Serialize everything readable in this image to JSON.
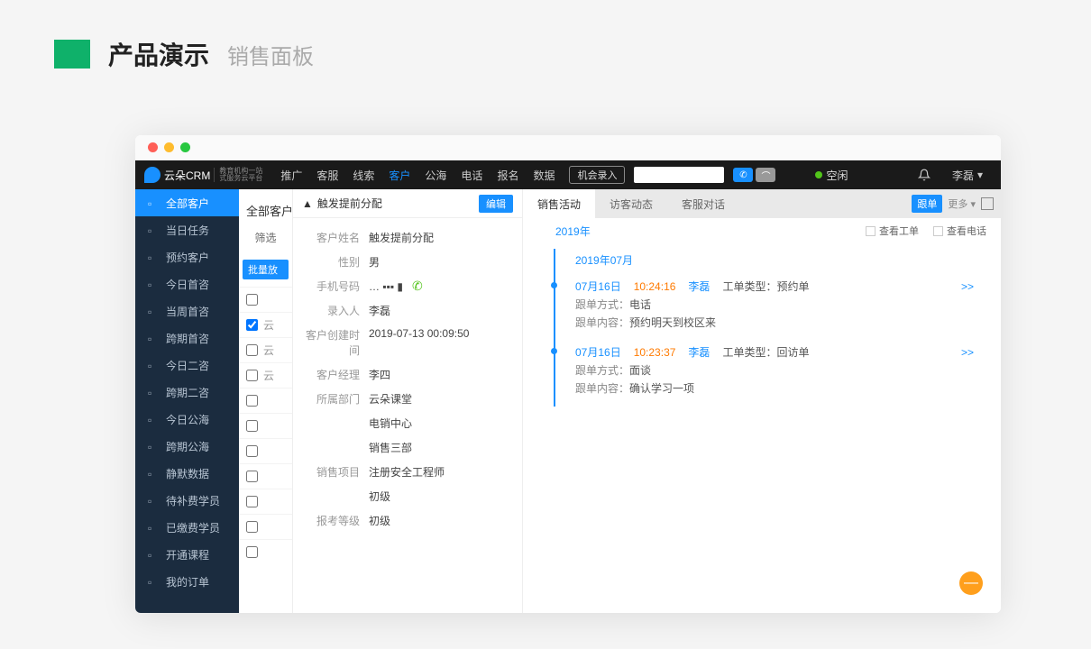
{
  "outer": {
    "title_main": "产品演示",
    "title_sub": "销售面板"
  },
  "topnav": {
    "logo": {
      "name": "云朵CRM",
      "tagline1": "教育机构一站",
      "tagline2": "式服务云平台"
    },
    "items": [
      "推广",
      "客服",
      "线索",
      "客户",
      "公海",
      "电话",
      "报名",
      "数据"
    ],
    "active_index": 3,
    "entry_btn": "机会录入",
    "status": "空闲",
    "user": "李磊"
  },
  "sidebar": {
    "items": [
      "全部客户",
      "当日任务",
      "预约客户",
      "今日首咨",
      "当周首咨",
      "跨期首咨",
      "今日二咨",
      "跨期二咨",
      "今日公海",
      "跨期公海",
      "静默数据",
      "待补费学员",
      "已缴费学员",
      "开通课程",
      "我的订单"
    ],
    "active_index": 0
  },
  "list": {
    "title": "全部客户",
    "filter_prefix": "筛选",
    "batch_btn": "批量放",
    "rows": [
      "",
      "云",
      "云",
      "云",
      "",
      "",
      "",
      "",
      "",
      "",
      ""
    ]
  },
  "detail": {
    "header_title": "触发提前分配",
    "edit_btn": "编辑",
    "fields": [
      {
        "label": "客户姓名",
        "value": "触发提前分配"
      },
      {
        "label": "性别",
        "value": "男"
      },
      {
        "label": "手机号码",
        "value": "… ▪▪▪ ▮",
        "phone": true
      },
      {
        "label": "录入人",
        "value": "李磊"
      },
      {
        "label": "客户创建时间",
        "value": "2019-07-13 00:09:50"
      },
      {
        "label": "客户经理",
        "value": "李四"
      },
      {
        "label": "所属部门",
        "value": "云朵课堂"
      },
      {
        "label": "",
        "value": "电销中心"
      },
      {
        "label": "",
        "value": "销售三部"
      },
      {
        "label": "销售项目",
        "value": "注册安全工程师"
      },
      {
        "label": "",
        "value": "初级"
      },
      {
        "label": "报考等级",
        "value": "初级"
      }
    ]
  },
  "activity": {
    "tabs": [
      "销售活动",
      "访客动态",
      "客服对话"
    ],
    "active_tab": 0,
    "follow_btn": "跟单",
    "more_link": "更多 ▾",
    "year": "2019年",
    "check_order": "查看工单",
    "check_phone": "查看电话",
    "month": "2019年07月",
    "entries": [
      {
        "date": "07月16日",
        "time": "10:24:16",
        "user": "李磊",
        "type_label": "工单类型：",
        "type": "预约单",
        "more": ">>",
        "lines": [
          {
            "k": "跟单方式：",
            "v": "电话"
          },
          {
            "k": "跟单内容：",
            "v": "预约明天到校区来"
          }
        ]
      },
      {
        "date": "07月16日",
        "time": "10:23:37",
        "user": "李磊",
        "type_label": "工单类型：",
        "type": "回访单",
        "more": ">>",
        "lines": [
          {
            "k": "跟单方式：",
            "v": "面谈"
          },
          {
            "k": "跟单内容：",
            "v": "确认学习一项"
          }
        ]
      }
    ]
  },
  "fab": "—"
}
